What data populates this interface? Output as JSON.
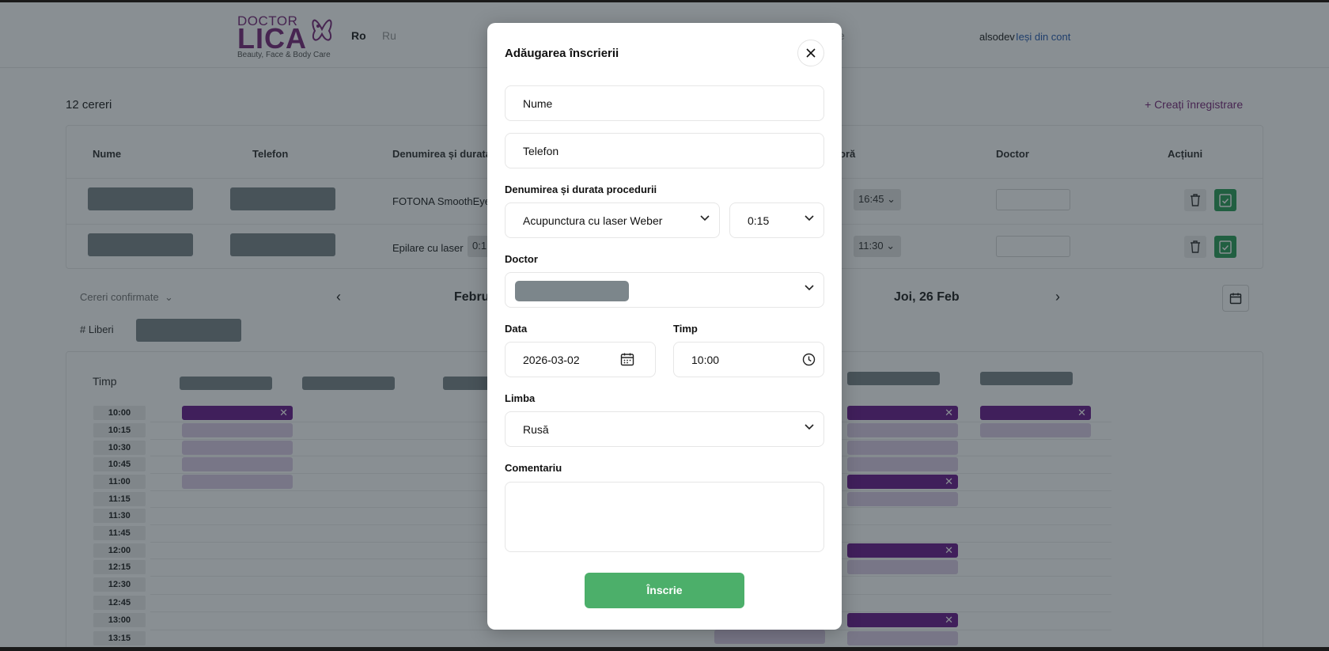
{
  "header": {
    "logo": {
      "line1": "DOCTOR",
      "line2": "LICA",
      "tagline": "Beauty, Face & Body Care"
    },
    "languages": {
      "ro": "Ro",
      "ru": "Ru"
    },
    "partial_nav_text": "e",
    "user": "alsodev",
    "logout": "Ieși din cont"
  },
  "requests": {
    "count_label": "12 cereri",
    "create_label": "+ Creați înregistrare",
    "columns": {
      "name": "Nume",
      "phone": "Telefon",
      "procedure": "Denumirea și durata",
      "hour": "oră",
      "doctor": "Doctor",
      "actions": "Acțiuni"
    },
    "rows": [
      {
        "procedure": "FOTONA SmoothEye",
        "time": "16:45"
      },
      {
        "procedure": "Epilare cu laser",
        "duration": "0:1",
        "time": "11:30"
      }
    ]
  },
  "calendar": {
    "filter_label": "Cereri confirmate",
    "title_left": "Februa",
    "title_right": "Joi, 26 Feb",
    "free_label": "# Liberi",
    "time_header": "Timp",
    "slots": [
      "10:00",
      "10:15",
      "10:30",
      "10:45",
      "11:00",
      "11:15",
      "11:30",
      "11:45",
      "12:00",
      "12:15",
      "12:30",
      "12:45",
      "13:00",
      "13:15"
    ]
  },
  "modal": {
    "title": "Adăugarea înscrierii",
    "name_placeholder": "Nume",
    "phone_placeholder": "Telefon",
    "procedure_label": "Denumirea și durata procedurii",
    "procedure_value": "Acupunctura cu laser Weber",
    "duration_value": "0:15",
    "doctor_label": "Doctor",
    "date_label": "Data",
    "date_value": "2026-03-02",
    "time_label": "Timp",
    "time_value": "10:00",
    "language_label": "Limba",
    "language_value": "Rusă",
    "comment_label": "Comentariu",
    "submit_label": "Înscrie"
  },
  "colors": {
    "brand": "#7a2a7a",
    "primary_green": "#4caf6a",
    "appointment_dark": "#6c1f8f",
    "appointment_light": "#dccde6",
    "link_blue": "#2a5db0"
  }
}
